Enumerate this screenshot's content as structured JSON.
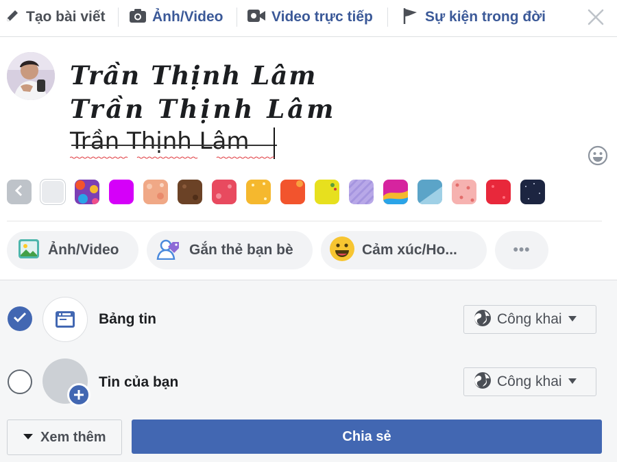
{
  "tabs": [
    {
      "label": "Tạo bài viết",
      "icon": "pencil-icon"
    },
    {
      "label": "Ảnh/Video",
      "icon": "camera-icon"
    },
    {
      "label": "Video trực tiếp",
      "icon": "live-video-icon"
    },
    {
      "label": "Sự kiện trong đời",
      "icon": "flag-icon"
    }
  ],
  "composer": {
    "line1": "Trần Thịnh Lâm",
    "line2": "Trần Thịnh Lâm",
    "line3": "Trần Thịnh Lâm"
  },
  "swatch_colors": [
    "#e9ebee",
    "#7b3fb5",
    "#d500f9",
    "#f0a886",
    "#6b4226",
    "#e84a5f",
    "#f5b82e",
    "#f2542d",
    "#e7e01e",
    "#b8a8e8",
    "#d6249f",
    "#5ba4c8",
    "#f6b2b0",
    "#e8283b",
    "#1c2541"
  ],
  "actions": [
    {
      "label": "Ảnh/Video",
      "icon": "photo-icon"
    },
    {
      "label": "Gắn thẻ bạn bè",
      "icon": "tag-friends-icon"
    },
    {
      "label": "Cảm xúc/Ho...",
      "icon": "smiley-icon"
    },
    {
      "label": "•••",
      "icon": "more-icon"
    }
  ],
  "share": {
    "news_feed_label": "Bảng tin",
    "story_label": "Tin của bạn",
    "audience_label": "Công khai",
    "audience_label_2": "Công khai",
    "more_label": "Xem thêm",
    "share_label": "Chia sẻ"
  },
  "colors": {
    "brand": "#4267b2",
    "tab_text": "#3b5998",
    "panel_bg": "#f5f6f7"
  }
}
